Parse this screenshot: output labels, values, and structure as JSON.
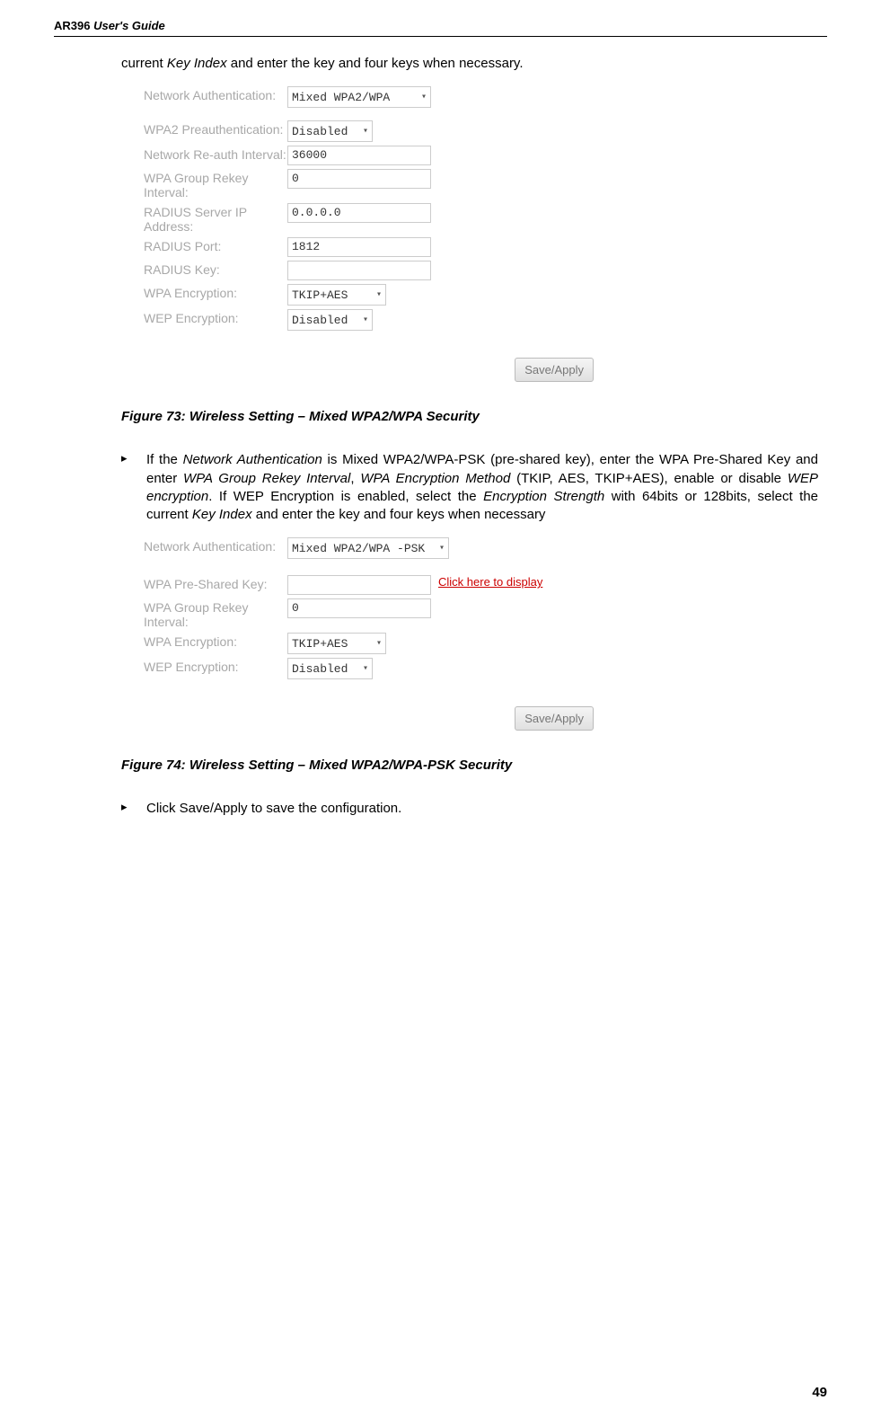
{
  "header": {
    "model": "AR396",
    "subtitle": " User's Guide"
  },
  "intro_text": "current Key Index and enter the key and four keys when necessary.",
  "form1": {
    "net_auth_label": "Network Authentication:",
    "net_auth_value": "Mixed WPA2/WPA",
    "wpa2_preauth_label": "WPA2 Preauthentication:",
    "wpa2_preauth_value": "Disabled",
    "reauth_label": "Network Re-auth Interval:",
    "reauth_value": "36000",
    "group_rekey_label": "WPA Group Rekey Interval:",
    "group_rekey_value": "0",
    "radius_ip_label": "RADIUS Server IP Address:",
    "radius_ip_value": "0.0.0.0",
    "radius_port_label": "RADIUS Port:",
    "radius_port_value": "1812",
    "radius_key_label": "RADIUS Key:",
    "radius_key_value": "",
    "wpa_enc_label": "WPA Encryption:",
    "wpa_enc_value": "TKIP+AES",
    "wep_enc_label": "WEP Encryption:",
    "wep_enc_value": "Disabled",
    "save_apply": "Save/Apply"
  },
  "figure73": "Figure 73: Wireless Setting – Mixed WPA2/WPA Security",
  "bullet1": {
    "p1": "If the ",
    "p2": "Network Authentication",
    "p3": " is Mixed WPA2/WPA-PSK (pre-shared key), enter the WPA Pre-Shared Key and enter ",
    "p4": "WPA Group Rekey Interval",
    "p5": ", ",
    "p6": "WPA Encryption Method",
    "p7": " (TKIP, AES, TKIP+AES), enable or disable ",
    "p8": "WEP encryption",
    "p9": ". If WEP Encryption is enabled, select the ",
    "p10": "Encryption Strength",
    "p11": " with 64bits or 128bits, select the current ",
    "p12": "Key Index",
    "p13": " and enter the key and four keys when necessary"
  },
  "form2": {
    "net_auth_label": "Network Authentication:",
    "net_auth_value": "Mixed WPA2/WPA -PSK",
    "psk_label": "WPA Pre-Shared Key:",
    "psk_value": "",
    "click_link": "Click here to display",
    "group_rekey_label": "WPA Group Rekey Interval:",
    "group_rekey_value": "0",
    "wpa_enc_label": "WPA Encryption:",
    "wpa_enc_value": "TKIP+AES",
    "wep_enc_label": "WEP Encryption:",
    "wep_enc_value": "Disabled",
    "save_apply": "Save/Apply"
  },
  "figure74": "Figure 74: Wireless Setting – Mixed WPA2/WPA-PSK Security",
  "bullet2": "Click Save/Apply to save the configuration.",
  "page_number": "49"
}
